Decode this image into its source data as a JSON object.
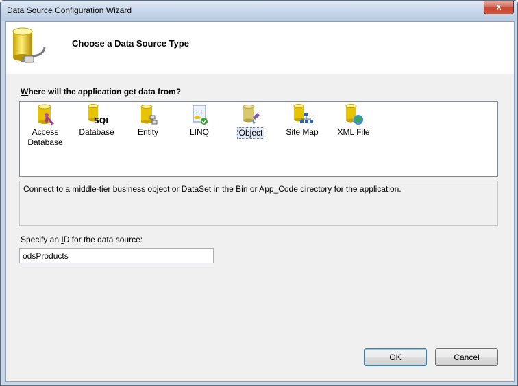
{
  "window": {
    "title": "Data Source Configuration Wizard",
    "close_glyph": "x"
  },
  "header": {
    "title": "Choose a Data Source Type",
    "icon": "database-plug-icon"
  },
  "section": {
    "prefix": "W",
    "rest": "here will the application get data from?"
  },
  "sources": [
    {
      "line1": "Access",
      "line2": "Database",
      "icon": "access-database-icon"
    },
    {
      "line1": "Database",
      "line2": "",
      "icon": "sql-database-icon"
    },
    {
      "line1": "Entity",
      "line2": "",
      "icon": "entity-icon"
    },
    {
      "line1": "LINQ",
      "line2": "",
      "icon": "linq-icon"
    },
    {
      "line1": "Object",
      "line2": "",
      "icon": "object-icon",
      "selected": true
    },
    {
      "line1": "Site Map",
      "line2": "",
      "icon": "site-map-icon"
    },
    {
      "line1": "XML File",
      "line2": "",
      "icon": "xml-file-icon"
    }
  ],
  "description": "Connect to a middle-tier business object or DataSet in the Bin or App_Code directory for the application.",
  "id_field": {
    "label_prefix": "Specify an ",
    "label_key": "I",
    "label_rest": "D for the data source:",
    "value": "odsProducts"
  },
  "buttons": {
    "ok": "OK",
    "cancel": "Cancel"
  }
}
